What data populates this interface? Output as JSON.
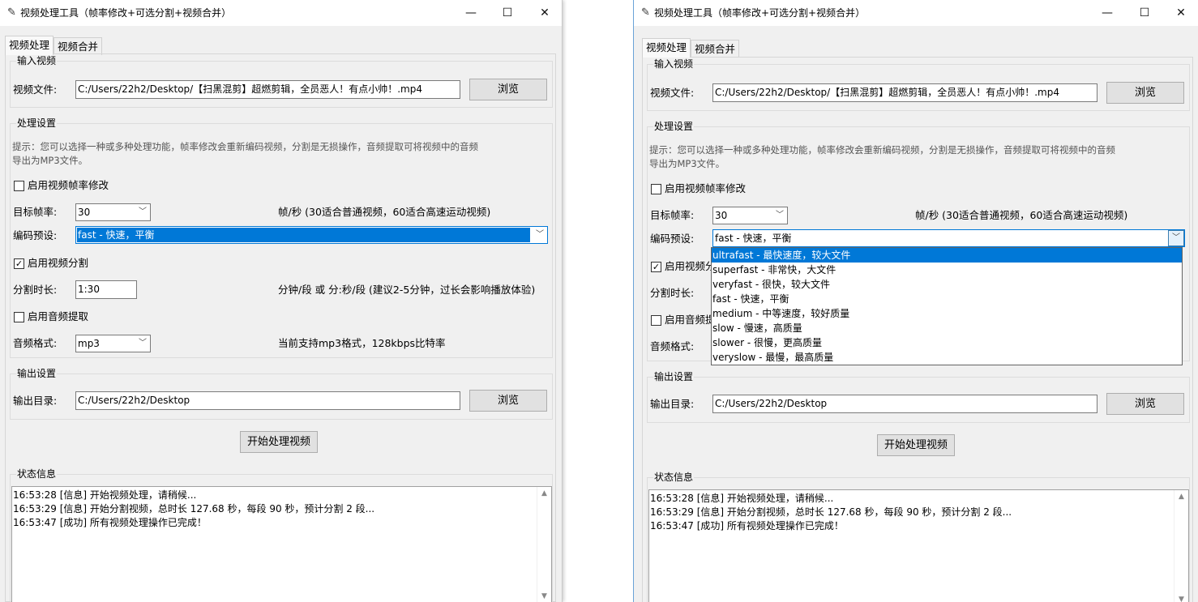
{
  "window": {
    "title": "视频处理工具（帧率修改+可选分割+视频合并）",
    "controls": {
      "minimize": "—",
      "maximize": "☐",
      "close": "✕"
    }
  },
  "tabs": [
    "视频处理",
    "视频合并"
  ],
  "input": {
    "section": "输入视频",
    "file_label": "视频文件:",
    "file_value": "C:/Users/22h2/Desktop/【扫黑混剪】超燃剪辑，全员恶人！有点小帅！.mp4",
    "browse": "浏览"
  },
  "settings": {
    "section": "处理设置",
    "hint_line1": "提示：您可以选择一种或多种处理功能，帧率修改会重新编码视频，分割是无损操作，音频提取可将视频中的音频",
    "hint_line2": "导出为MP3文件。",
    "fps_enable": "启用视频帧率修改",
    "fps_enabled": false,
    "fps_label": "目标帧率:",
    "fps_value": "30",
    "fps_note": "帧/秒 (30适合普通视频，60适合高速运动视频)",
    "preset_label": "编码预设:",
    "preset_value": "fast - 快速，平衡",
    "split_enable": "启用视频分割",
    "split_enabled": true,
    "split_label": "分割时长:",
    "split_value": "1:30",
    "split_note": "分钟/段 或 分:秒/段 (建议2-5分钟，过长会影响播放体验)",
    "audio_enable": "启用音频提取",
    "audio_enabled": false,
    "audio_label": "音频格式:",
    "audio_value": "mp3",
    "audio_note": "当前支持mp3格式，128kbps比特率"
  },
  "output": {
    "section": "输出设置",
    "dir_label": "输出目录:",
    "dir_value": "C:/Users/22h2/Desktop",
    "browse": "浏览"
  },
  "start_button": "开始处理视频",
  "status": {
    "section": "状态信息",
    "lines": [
      "16:53:28 [信息] 开始视频处理，请稍候...",
      "16:53:29 [信息] 开始分割视频，总时长 127.68 秒，每段 90 秒，预计分割 2 段...",
      "16:53:47 [成功] 所有视频处理操作已完成！"
    ]
  },
  "preset_dropdown": {
    "options": [
      "ultrafast - 最快速度，较大文件",
      "superfast - 非常快，大文件",
      "veryfast - 很快，较大文件",
      "fast - 快速，平衡",
      "medium - 中等速度，较好质量",
      "slow - 慢速，高质量",
      "slower - 很慢，更高质量",
      "veryslow - 最慢，最高质量"
    ],
    "highlighted_index": 0
  },
  "partial_right": {
    "split_enable_prefix": "启用视频分",
    "split_label_prefix": "分割时长:",
    "audio_enable_prefix": "启用音频提"
  },
  "colors": {
    "accent": "#0078d7",
    "window_bg": "#f0f0f0"
  }
}
